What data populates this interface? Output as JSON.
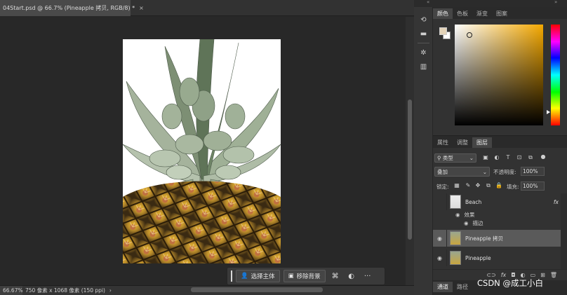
{
  "document": {
    "tab_title": "04Start.psd @ 66.7% (Pineapple 拷贝, RGB/8) *",
    "close_glyph": "×"
  },
  "status": {
    "zoom": "66.67%",
    "doc_info": "750 像素 x 1068 像素 (150 ppi)",
    "arrow": "›"
  },
  "taskbar": {
    "select_subject": "选择主体",
    "remove_background": "移除背景",
    "more": "···"
  },
  "color_panel": {
    "tabs": [
      {
        "label": "颜色",
        "active": true
      },
      {
        "label": "色板",
        "active": false
      },
      {
        "label": "渐变",
        "active": false
      },
      {
        "label": "图案",
        "active": false
      }
    ],
    "foreground": "#e3d3b8",
    "background": "#ffffff"
  },
  "layers_panel": {
    "tabs": [
      {
        "label": "属性",
        "active": false
      },
      {
        "label": "调整",
        "active": false
      },
      {
        "label": "图层",
        "active": true
      }
    ],
    "filter_kind": "类型",
    "blend_mode": "叠加",
    "opacity_label": "不透明度:",
    "opacity_value": "100%",
    "lock_label": "锁定:",
    "fill_label": "填充:",
    "fill_value": "100%",
    "layers": [
      {
        "name": "Beach",
        "visible": false,
        "selected": false,
        "fx": "fx"
      },
      {
        "name": "Pineapple 拷贝",
        "visible": true,
        "selected": true
      },
      {
        "name": "Pineapple",
        "visible": true,
        "selected": false
      }
    ],
    "effects_label": "效果",
    "stroke_label": "描边"
  },
  "channels_panel": {
    "tabs": [
      {
        "label": "通道",
        "active": true
      },
      {
        "label": "路径",
        "active": false
      }
    ]
  },
  "watermark": "CSDN @成工小白",
  "icons": [
    "history-icon",
    "comment-icon",
    "brush-settings-icon",
    "histogram-icon",
    "eye-icon",
    "lock-icon",
    "link-icon",
    "fx-icon",
    "mask-icon",
    "folder-icon",
    "new-layer-icon",
    "trash-icon"
  ]
}
